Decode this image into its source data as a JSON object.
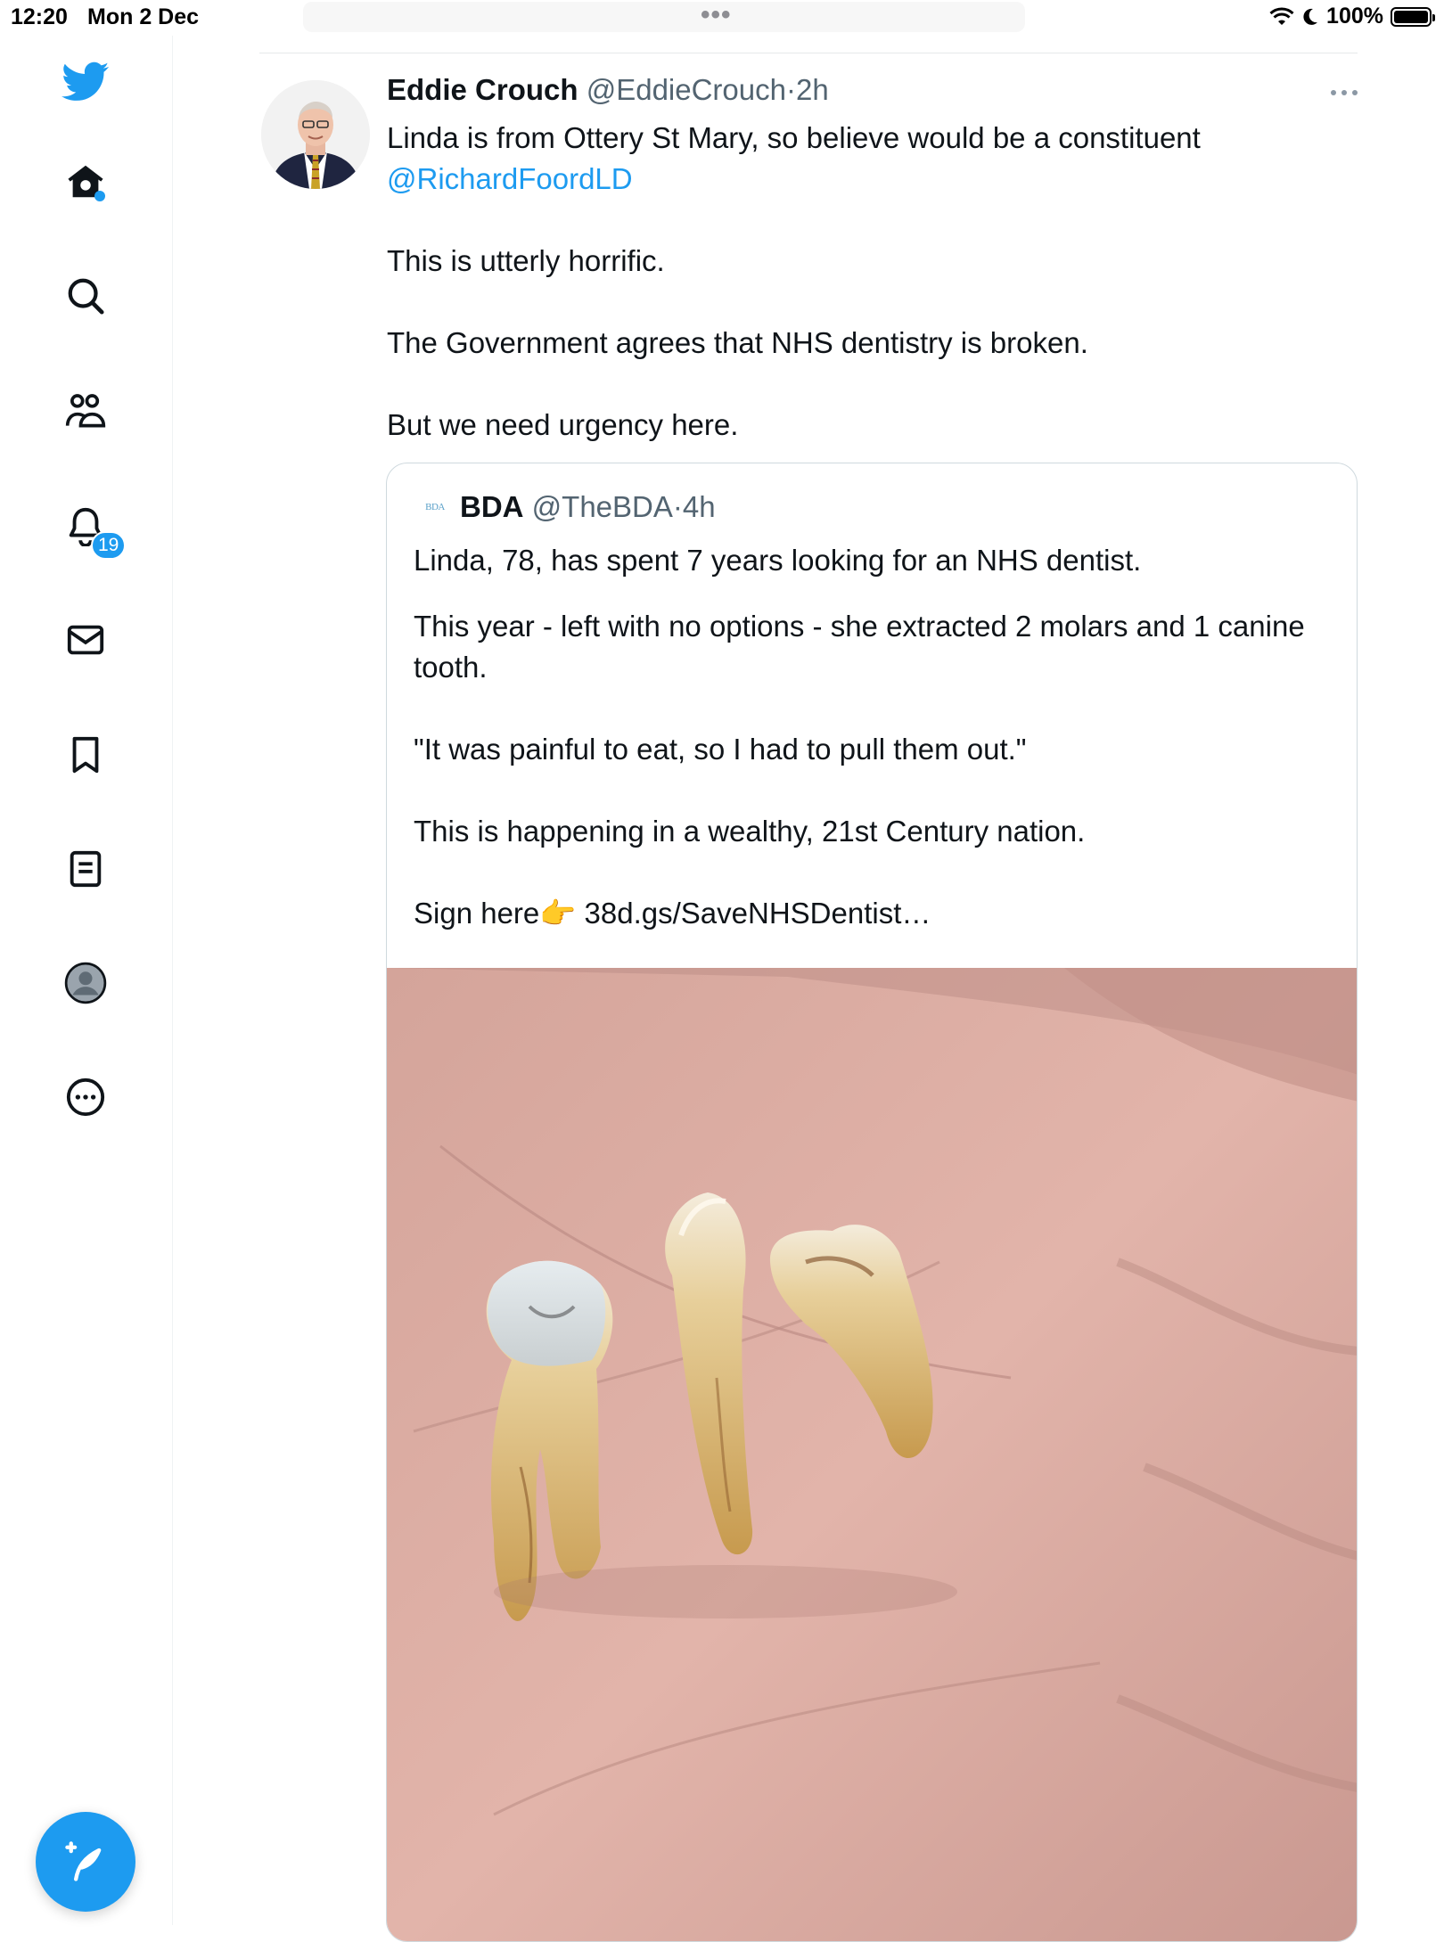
{
  "status_bar": {
    "time": "12:20",
    "date": "Mon 2 Dec",
    "battery": "100%"
  },
  "sidebar": {
    "items": [
      {
        "name": "twitter-logo-icon"
      },
      {
        "name": "home-icon"
      },
      {
        "name": "explore-icon"
      },
      {
        "name": "communities-icon"
      },
      {
        "name": "notifications-icon",
        "badge": "19"
      },
      {
        "name": "messages-icon"
      },
      {
        "name": "bookmarks-icon"
      },
      {
        "name": "lists-icon"
      },
      {
        "name": "profile-icon"
      },
      {
        "name": "more-icon"
      }
    ],
    "notifications_badge": "19",
    "accent_color": "#1d9bf0"
  },
  "tweet": {
    "author_name": "Eddie Crouch",
    "author_handle": "@EddieCrouch",
    "separator": "·",
    "time": "2h",
    "text_line1": "Linda is from Ottery St Mary, so believe would be a constituent",
    "mention": "@RichardFoordLD",
    "para2": "This is utterly horrific.",
    "para3": "The Government agrees that NHS dentistry is broken.",
    "para4": "But we need urgency here."
  },
  "quoted_tweet": {
    "logo_text": "BDA",
    "author_name": "BDA",
    "author_handle": "@TheBDA",
    "separator": "·",
    "time": "4h",
    "para1": "Linda, 78, has spent 7 years looking for an NHS dentist.",
    "para2": "This year - left with no options - she extracted 2 molars and 1 canine tooth.",
    "para3": "\"It was painful to eat, so I had to pull them out.\"",
    "para4": "This is happening in a wealthy, 21st Century nation.",
    "para5_prefix": "Sign here👉 ",
    "link": "38d.gs/SaveNHSDentist…"
  },
  "colors": {
    "text_primary": "#0f1419",
    "text_secondary": "#536471",
    "link": "#1d9bf0",
    "border": "#cfd9de"
  }
}
